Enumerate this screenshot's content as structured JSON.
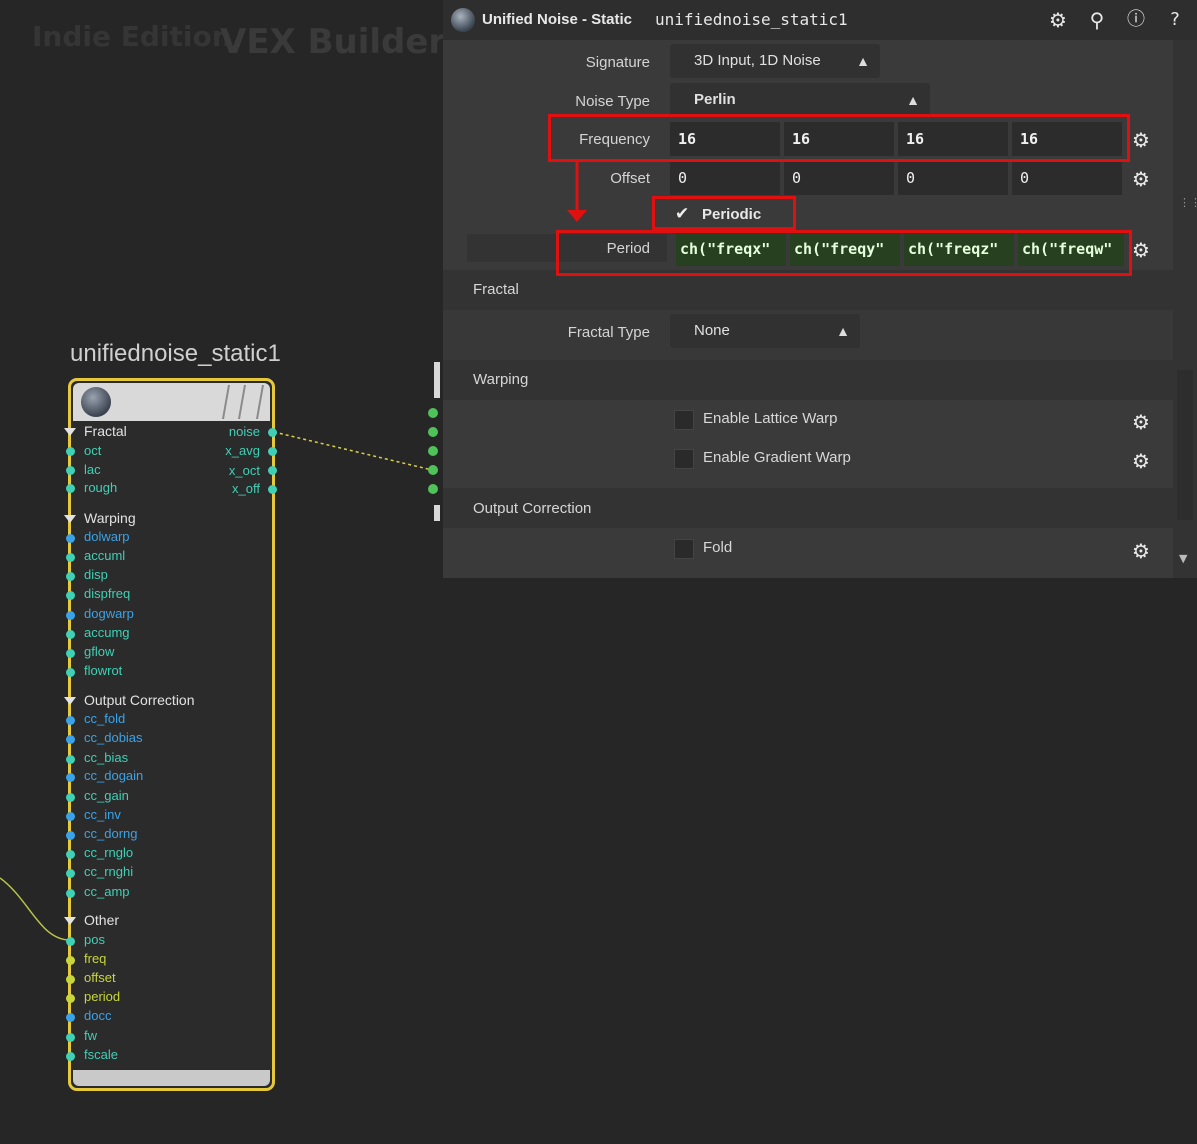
{
  "context": {
    "edition": "Indie Edition",
    "builder": "VEX Builder"
  },
  "node": {
    "name": "unifiednoise_static1",
    "output_ports": [
      "noise",
      "x_avg",
      "x_oct",
      "x_off"
    ],
    "groups": {
      "fractal": {
        "label": "Fractal",
        "ports": [
          "oct",
          "lac",
          "rough"
        ]
      },
      "warping": {
        "label": "Warping",
        "ports": [
          "dolwarp",
          "accuml",
          "disp",
          "dispfreq",
          "dogwarp",
          "accumg",
          "gflow",
          "flowrot"
        ]
      },
      "output_correction": {
        "label": "Output Correction",
        "ports": [
          "cc_fold",
          "cc_dobias",
          "cc_bias",
          "cc_dogain",
          "cc_gain",
          "cc_inv",
          "cc_dorng",
          "cc_rnglo",
          "cc_rnghi",
          "cc_amp"
        ]
      },
      "other": {
        "label": "Other",
        "ports": [
          "pos",
          "freq",
          "offset",
          "period",
          "docc",
          "fw",
          "fscale"
        ]
      }
    }
  },
  "panel": {
    "node_type": "Unified Noise - Static",
    "node_name": "unifiednoise_static1",
    "icons": [
      "gear-icon",
      "search-icon",
      "info-icon",
      "help-icon"
    ],
    "signature": {
      "label": "Signature",
      "value": "3D Input, 1D Noise"
    },
    "noise_type": {
      "label": "Noise Type",
      "value": "Perlin"
    },
    "frequency": {
      "label": "Frequency",
      "values": [
        "16",
        "16",
        "16",
        "16"
      ]
    },
    "offset": {
      "label": "Offset",
      "values": [
        "0",
        "0",
        "0",
        "0"
      ]
    },
    "periodic": {
      "label": "Periodic",
      "checked": true
    },
    "period": {
      "label": "Period",
      "values": [
        "ch(\"freqx\"",
        "ch(\"freqy\"",
        "ch(\"freqz\"",
        "ch(\"freqw\""
      ]
    },
    "fractal": {
      "section": "Fractal",
      "type_label": "Fractal Type",
      "type_value": "None"
    },
    "warping": {
      "section": "Warping",
      "lattice": "Enable Lattice Warp",
      "gradient": "Enable Gradient Warp"
    },
    "output_correction": {
      "section": "Output Correction",
      "fold": "Fold"
    }
  },
  "colors": {
    "node_border": "#e6c93a",
    "highlight": "#e01010",
    "expr_field": "#27401f"
  }
}
